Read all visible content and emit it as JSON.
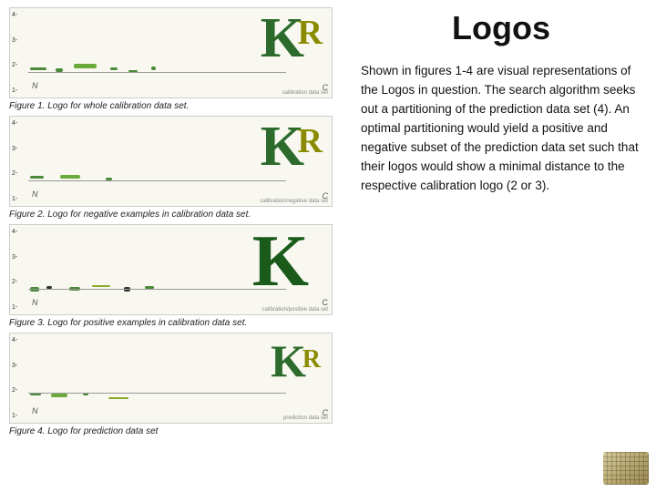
{
  "page": {
    "title": "Logos",
    "description": "Shown in figures 1-4 are visual representations of the Logos in question.  The search algorithm seeks out a partitioning of the prediction data set (4).  An optimal partitioning would yield a positive and negative subset of the prediction data set such that their logos would show a minimal distance to the respective calibration logo (2 or 3).",
    "figures": [
      {
        "id": "fig1",
        "caption": "Figure 1. Logo for whole calibration data set.",
        "type": "whole"
      },
      {
        "id": "fig2",
        "caption": "Figure 2. Logo for negative examples in calibration data set.",
        "type": "negative"
      },
      {
        "id": "fig3",
        "caption": "Figure 3. Logo for positive examples in calibration data set.",
        "type": "positive"
      },
      {
        "id": "fig4",
        "caption": "Figure 4. Logo for prediction data set",
        "type": "prediction"
      }
    ],
    "y_axis_labels": [
      "4-",
      "3-",
      "2-",
      "1-"
    ],
    "axis_labels": {
      "n": "N",
      "c": "C"
    }
  }
}
